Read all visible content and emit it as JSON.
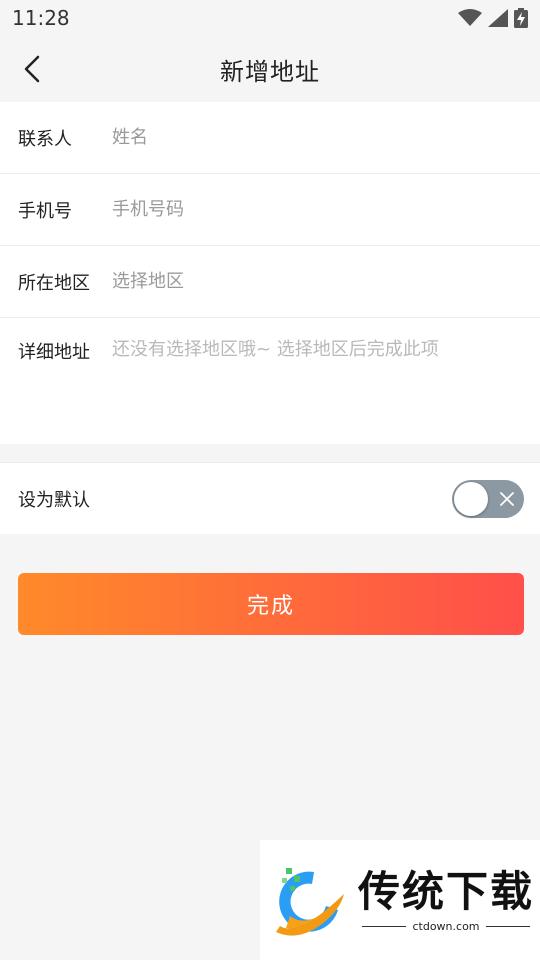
{
  "status_bar": {
    "time": "11:28",
    "icons": [
      "wifi-icon",
      "signal-icon",
      "battery-charging-icon"
    ]
  },
  "header": {
    "title": "新增地址",
    "back_icon": "chevron-left-icon"
  },
  "form": {
    "contact_label": "联系人",
    "contact_placeholder": "姓名",
    "phone_label": "手机号",
    "phone_placeholder": "手机号码",
    "region_label": "所在地区",
    "region_placeholder": "选择地区",
    "detail_label": "详细地址",
    "detail_placeholder": "还没有选择地区哦~ 选择地区后完成此项"
  },
  "default_setting": {
    "label": "设为默认",
    "enabled": false
  },
  "submit": {
    "label": "完成"
  },
  "colors": {
    "gradient_start": "#ff8a2a",
    "gradient_end": "#ff4f4a",
    "toggle_off": "#8c98a2",
    "background": "#f5f5f5"
  },
  "watermark": {
    "title": "传统下载",
    "subtitle": "ctdown.com"
  }
}
